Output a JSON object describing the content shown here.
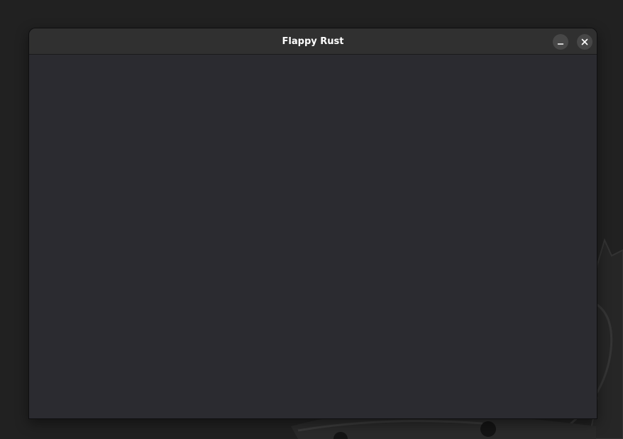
{
  "window": {
    "title": "Flappy Rust"
  },
  "titlebar_buttons": {
    "minimize_icon": "minimize-icon",
    "close_icon": "close-icon"
  },
  "colors": {
    "desktop_background": "#212121",
    "titlebar": "#303030",
    "content": "#2b2b30",
    "button": "#474747",
    "title_text": "#ffffff"
  }
}
